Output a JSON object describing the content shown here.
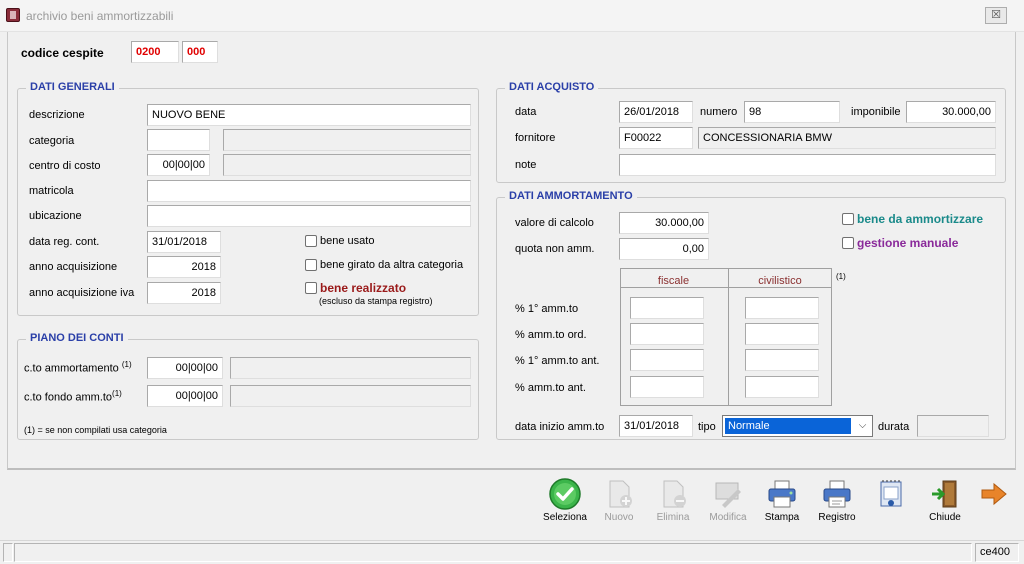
{
  "window": {
    "title": "archivio beni ammortizzabili",
    "close_label": "☒"
  },
  "codice": {
    "label": "codice cespite",
    "part1": "0200",
    "part2": "000"
  },
  "generali": {
    "legend": "DATI GENERALI",
    "descrizione_label": "descrizione",
    "descrizione": "NUOVO BENE",
    "categoria_label": "categoria",
    "categoria": "",
    "categoria_desc": "",
    "centro_label": "centro di costo",
    "centro": "00|00|00",
    "centro_desc": "",
    "matricola_label": "matricola",
    "matricola": "",
    "ubicazione_label": "ubicazione",
    "ubicazione": "",
    "data_reg_label": "data reg. cont.",
    "data_reg": "31/01/2018",
    "anno_acq_label": "anno acquisizione",
    "anno_acq": "2018",
    "anno_iva_label": "anno acquisizione iva",
    "anno_iva": "2018",
    "bene_usato": "bene usato",
    "bene_girato": "bene girato da altra categoria",
    "bene_realizzato": "bene realizzato",
    "bene_realizzato_note": "(escluso da stampa registro)"
  },
  "piano": {
    "legend": "PIANO DEI CONTI",
    "ammortamento_label": "c.to ammortamento",
    "ammortamento_sup": "(1)",
    "ammortamento": "00|00|00",
    "ammortamento_desc": "",
    "fondo_label": "c.to fondo amm.to",
    "fondo_sup": "(1)",
    "fondo": "00|00|00",
    "fondo_desc": "",
    "note": "(1) = se non compilati usa categoria"
  },
  "acquisto": {
    "legend": "DATI ACQUISTO",
    "data_label": "data",
    "data": "26/01/2018",
    "numero_label": "numero",
    "numero": "98",
    "imponibile_label": "imponibile",
    "imponibile": "30.000,00",
    "fornitore_label": "fornitore",
    "fornitore": "F00022",
    "fornitore_desc": "CONCESSIONARIA BMW",
    "note_label": "note",
    "note": ""
  },
  "ammortamento": {
    "legend": "DATI AMMORTAMENTO",
    "valore_label": "valore di calcolo",
    "valore": "30.000,00",
    "quota_label": "quota non amm.",
    "quota": "0,00",
    "bene_da_amm": "bene da ammortizzare",
    "gestione_manuale": "gestione manuale",
    "col_fiscale": "fiscale",
    "col_civilistico": "civilistico",
    "col_note": "(1)",
    "rows": [
      "% 1° amm.to",
      "% amm.to ord.",
      "% 1° amm.to ant.",
      "% amm.to ant."
    ],
    "data_inizio_label": "data inizio amm.to",
    "data_inizio": "31/01/2018",
    "tipo_label": "tipo",
    "tipo": "Normale",
    "durata_label": "durata",
    "durata": ""
  },
  "toolbar": {
    "seleziona": "Seleziona",
    "nuovo": "Nuovo",
    "elimina": "Elimina",
    "modifica": "Modifica",
    "stampa": "Stampa",
    "registro": "Registro",
    "chiude": "Chiude"
  },
  "status": {
    "code": "ce400"
  },
  "colors": {
    "legend": "#2a3fa8",
    "red": "#e00000",
    "teal": "#1a8a8a",
    "purple": "#8a2a9a",
    "dark_red": "#9a1a1a",
    "select_blue": "#0a64d8"
  }
}
